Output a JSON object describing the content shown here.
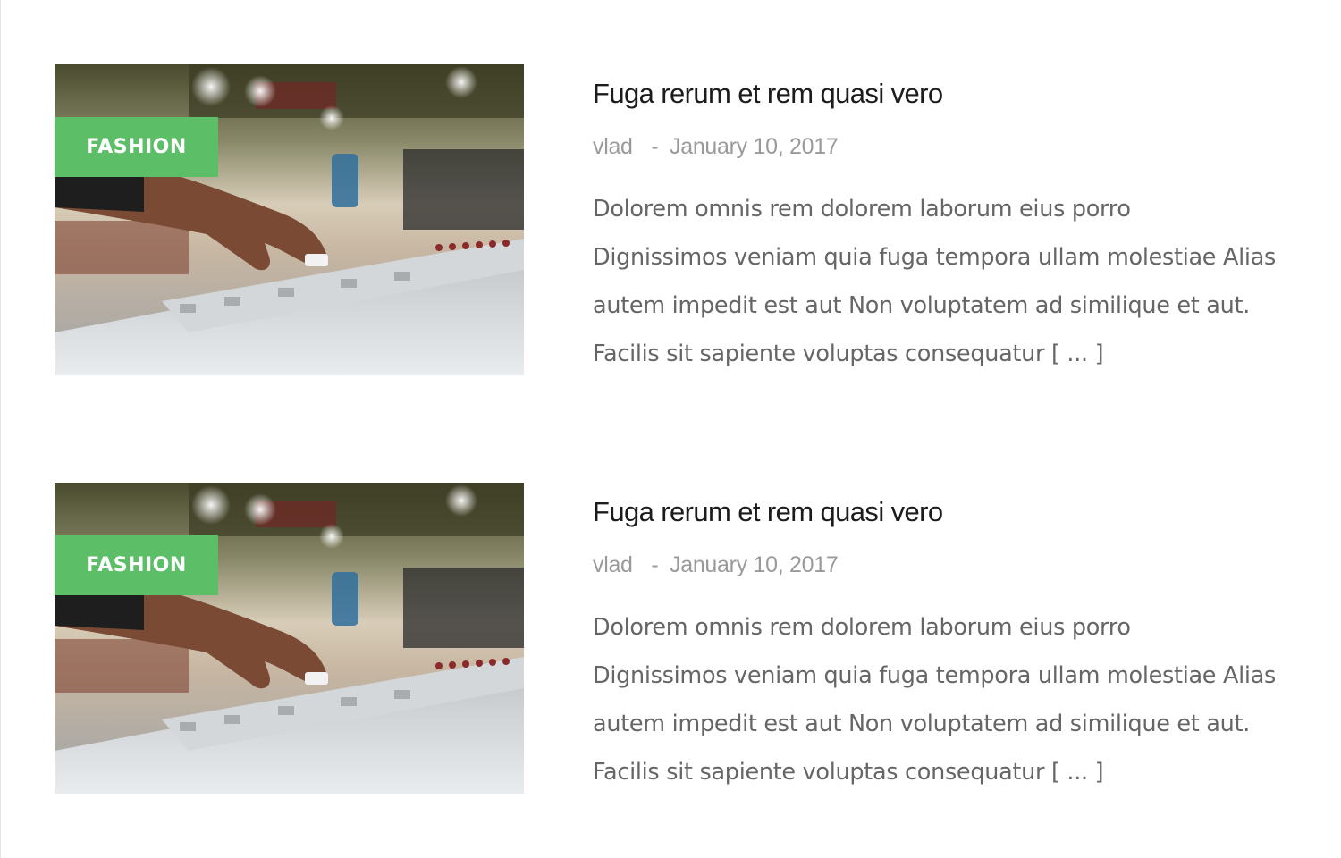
{
  "posts": [
    {
      "category": "FASHION",
      "title": "Fuga rerum et rem quasi vero",
      "author": "vlad",
      "separator": "-",
      "date": "January 10, 2017",
      "excerpt_lines": [
        "Dolorem omnis rem dolorem laborum eius porro",
        "Dignissimos veniam quia fuga tempora ullam molestiae Alias",
        "autem impedit est aut Non voluptatem ad similique et aut.",
        "Facilis sit sapiente voluptas consequatur"
      ],
      "read_more": "[ ... ]"
    },
    {
      "category": "FASHION",
      "title": "Fuga rerum et rem quasi vero",
      "author": "vlad",
      "separator": "-",
      "date": "January 10, 2017",
      "excerpt_lines": [
        "Dolorem omnis rem dolorem laborum eius porro",
        "Dignissimos veniam quia fuga tempora ullam molestiae Alias",
        "autem impedit est aut Non voluptatem ad similique et aut.",
        "Facilis sit sapiente voluptas consequatur"
      ],
      "read_more": "[ ... ]"
    }
  ],
  "colors": {
    "badge": "#5cbf67",
    "title": "#1c1c1c",
    "meta": "#9a9a9a",
    "excerpt": "#666666"
  }
}
